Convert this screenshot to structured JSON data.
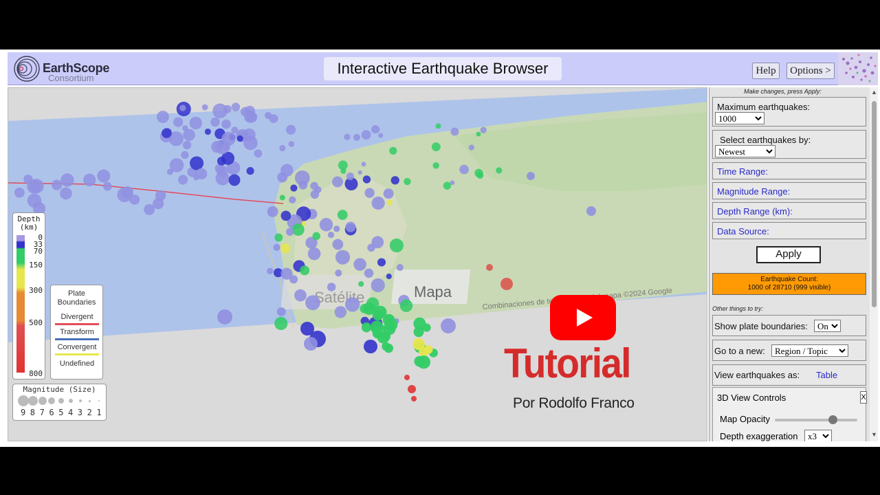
{
  "app": {
    "brand": "EarthScope",
    "brand_sub": "Consortium",
    "title": "Interactive Earthquake Browser",
    "help_label": "Help",
    "options_label": "Options >"
  },
  "map": {
    "tabs": [
      "Satélite",
      "Mapa"
    ],
    "attribution": "Combinaciones de teclas   Datos del mapa ©2024 Google"
  },
  "depth_legend": {
    "title_line1": "Depth",
    "title_line2": "(km)",
    "ticks": [
      "0",
      "33",
      "70",
      "150",
      "300",
      "500",
      "800"
    ],
    "colors": {
      "shallow": "#9090e0",
      "blue": "#3333cc",
      "green": "#33cc66",
      "yellow": "#e6e64d",
      "orange": "#e68a33",
      "red": "#e03333"
    }
  },
  "plate_legend": {
    "title_line1": "Plate",
    "title_line2": "Boundaries",
    "items": [
      {
        "label": "Divergent",
        "color": "#e34b5a"
      },
      {
        "label": "Transform",
        "color": "#4a6fb5"
      },
      {
        "label": "Convergent",
        "color": "#e6e64d"
      },
      {
        "label": "Undefined",
        "color": "#ffffff"
      }
    ]
  },
  "magnitude_legend": {
    "title": "Magnitude (Size)",
    "values": [
      "9",
      "8",
      "7",
      "6",
      "5",
      "4",
      "3",
      "2",
      "1"
    ]
  },
  "side_panel": {
    "make_changes_note": "Make changes, press Apply:",
    "max_eq_label": "Maximum earthquakes:",
    "max_eq_value": "1000",
    "select_by_label": "Select earthquakes by:",
    "select_by_value": "Newest",
    "time_range": "Time Range:",
    "magnitude_range": "Magnitude Range:",
    "depth_range": "Depth Range (km):",
    "data_source": "Data Source:",
    "apply_label": "Apply",
    "count_title": "Earthquake Count:",
    "count_value": "1000 of 28710 (999 visible)",
    "other_things_note": "Other things to try:",
    "plate_bound_label": "Show plate boundaries:",
    "plate_bound_value": "On",
    "goto_label": "Go to a new:",
    "goto_value": "Region / Topic",
    "view_as_label": "View earthquakes as:",
    "view_as_link": "Table",
    "controls_3d_title": "3D View Controls",
    "controls_3d_close": "X",
    "map_opacity_label": "Map Opacity",
    "map_opacity_value": 0.68,
    "depth_exag_label": "Depth exaggeration",
    "depth_exag_value": "x3"
  },
  "overlay": {
    "title": "Tutorial",
    "subtitle": "Por Rodolfo Franco",
    "play_color": "#ff0000"
  }
}
